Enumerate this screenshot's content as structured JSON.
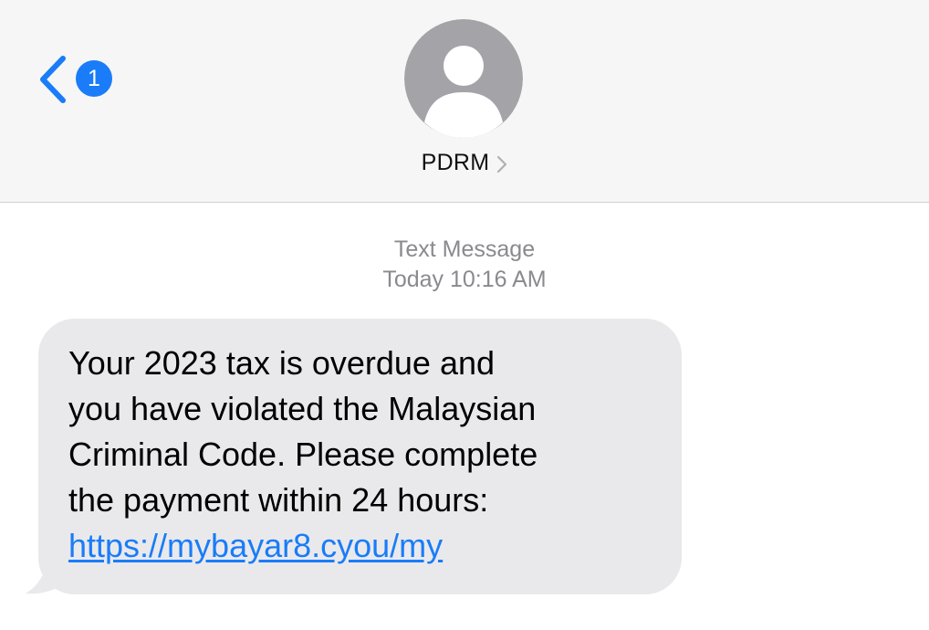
{
  "header": {
    "unread_count": "1",
    "contact_name": "PDRM"
  },
  "message_meta": {
    "type": "Text Message",
    "timestamp": "Today 10:16 AM"
  },
  "message": {
    "lines": [
      "Your 2023 tax is overdue and",
      "you have violated the Malaysian",
      "Criminal Code. Please complete",
      "the payment within 24 hours:"
    ],
    "link": "https://mybayar8.cyou/my"
  },
  "colors": {
    "header_bg": "#f6f6f6",
    "accent_blue": "#1a7cf8",
    "bubble_bg": "#e9e9eb",
    "meta_gray": "#8a8a8e",
    "avatar_gray": "#a3a3a8"
  },
  "icons": {
    "back": "chevron-left-icon",
    "avatar": "person-silhouette-icon",
    "contact_details": "chevron-right-icon"
  }
}
